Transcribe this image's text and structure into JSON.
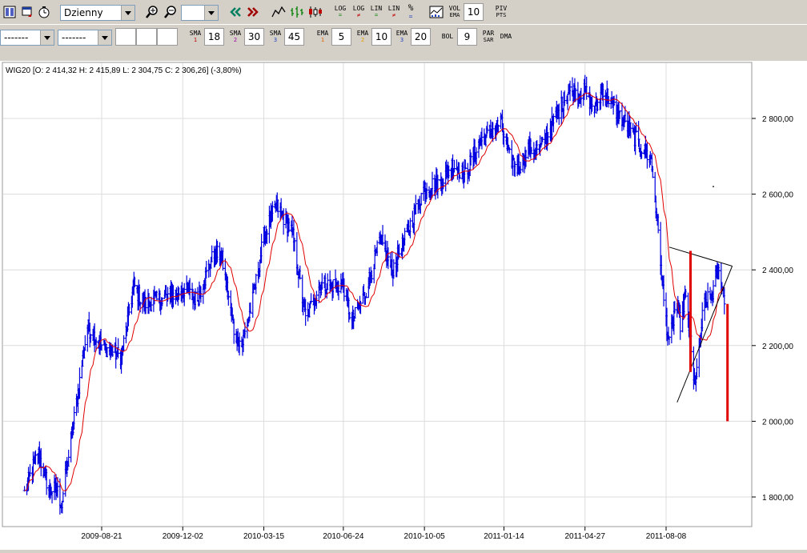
{
  "toolbar": {
    "interval": "Dzienny",
    "period_value": "10",
    "sma_label": "SMA",
    "ema_label": "EMA",
    "sma": [
      {
        "idx": "1",
        "value": "18"
      },
      {
        "idx": "2",
        "value": "30"
      },
      {
        "idx": "3",
        "value": "45"
      }
    ],
    "ema": [
      {
        "idx": "1",
        "value": "5"
      },
      {
        "idx": "2",
        "value": "10"
      },
      {
        "idx": "3",
        "value": "20"
      }
    ],
    "bol_label": "BOL",
    "bol_value": "9",
    "parsar_label1": "PAR",
    "parsar_label2": "SAR",
    "dma_label": "DMA",
    "vol_ema_1": "VOL",
    "vol_ema_2": "EMA",
    "piv_1": "PIV",
    "piv_2": "PTS",
    "log1": "LOG",
    "log2": "LOG",
    "lin1": "LIN",
    "lin2": "LIN",
    "percent": "%",
    "combo_a": "-------",
    "combo_b": "-------"
  },
  "colors": {
    "price": "#0000e0",
    "ma": "#e00000",
    "grid": "#dcdcdc",
    "marker": "#e00000",
    "trendline": "#000000"
  },
  "chart_data": {
    "type": "line",
    "title": "WIG20 [O: 2 414,32  H: 2 415,89  L: 2 304,75  C: 2 306,26] (-3,80%)",
    "y_ticks": [
      "2 800,00",
      "2 600,00",
      "2 400,00",
      "2 200,00",
      "2 000,00",
      "1 800,00"
    ],
    "x_ticks": [
      "2009-08-21",
      "2009-12-02",
      "2010-03-15",
      "2010-06-24",
      "2010-10-05",
      "2011-01-14",
      "2011-04-27",
      "2011-08-08"
    ],
    "ylim": [
      1740,
      2920
    ],
    "xlabel": "",
    "ylabel": "",
    "anchors": [
      [
        "2009-05-15",
        1810
      ],
      [
        "2009-06-01",
        1920
      ],
      [
        "2009-06-15",
        1820
      ],
      [
        "2009-06-25",
        1820
      ],
      [
        "2009-07-01",
        1780
      ],
      [
        "2009-07-20",
        2050
      ],
      [
        "2009-08-03",
        2250
      ],
      [
        "2009-08-21",
        2200
      ],
      [
        "2009-09-15",
        2170
      ],
      [
        "2009-10-01",
        2360
      ],
      [
        "2009-10-12",
        2310
      ],
      [
        "2009-11-02",
        2320
      ],
      [
        "2009-11-25",
        2340
      ],
      [
        "2009-12-02",
        2350
      ],
      [
        "2009-12-20",
        2320
      ],
      [
        "2010-01-10",
        2440
      ],
      [
        "2010-01-20",
        2440
      ],
      [
        "2010-02-05",
        2240
      ],
      [
        "2010-02-15",
        2200
      ],
      [
        "2010-03-01",
        2320
      ],
      [
        "2010-03-15",
        2490
      ],
      [
        "2010-03-31",
        2570
      ],
      [
        "2010-04-20",
        2500
      ],
      [
        "2010-05-07",
        2270
      ],
      [
        "2010-05-25",
        2360
      ],
      [
        "2010-06-10",
        2360
      ],
      [
        "2010-06-24",
        2360
      ],
      [
        "2010-07-05",
        2260
      ],
      [
        "2010-07-22",
        2340
      ],
      [
        "2010-08-10",
        2480
      ],
      [
        "2010-08-25",
        2400
      ],
      [
        "2010-09-10",
        2480
      ],
      [
        "2010-10-05",
        2620
      ],
      [
        "2010-10-25",
        2630
      ],
      [
        "2010-11-10",
        2680
      ],
      [
        "2010-11-25",
        2650
      ],
      [
        "2010-12-15",
        2740
      ],
      [
        "2011-01-10",
        2790
      ],
      [
        "2011-01-20",
        2700
      ],
      [
        "2011-02-01",
        2670
      ],
      [
        "2011-02-15",
        2720
      ],
      [
        "2011-03-01",
        2720
      ],
      [
        "2011-03-20",
        2800
      ],
      [
        "2011-04-05",
        2870
      ],
      [
        "2011-04-27",
        2870
      ],
      [
        "2011-05-10",
        2820
      ],
      [
        "2011-05-20",
        2880
      ],
      [
        "2011-06-05",
        2820
      ],
      [
        "2011-06-20",
        2780
      ],
      [
        "2011-07-05",
        2730
      ],
      [
        "2011-07-20",
        2690
      ],
      [
        "2011-07-28",
        2520
      ],
      [
        "2011-08-05",
        2320
      ],
      [
        "2011-08-12",
        2200
      ],
      [
        "2011-08-20",
        2310
      ],
      [
        "2011-08-26",
        2260
      ],
      [
        "2011-09-01",
        2330
      ],
      [
        "2011-09-07",
        2230
      ],
      [
        "2011-09-12",
        2100
      ],
      [
        "2011-09-18",
        2150
      ],
      [
        "2011-09-24",
        2300
      ],
      [
        "2011-09-30",
        2320
      ],
      [
        "2011-10-06",
        2340
      ],
      [
        "2011-10-12",
        2400
      ],
      [
        "2011-10-18",
        2360
      ],
      [
        "2011-10-21",
        2310
      ]
    ],
    "red_bars": [
      {
        "date": "2011-09-08",
        "from": 2450,
        "to": 2130
      },
      {
        "date": "2011-10-25",
        "from": 2310,
        "to": 2000
      }
    ],
    "trendlines": [
      {
        "from": [
          "2011-08-12",
          2460
        ],
        "to": [
          "2011-10-31",
          2410
        ]
      },
      {
        "from": [
          "2011-08-22",
          2050
        ],
        "to": [
          "2011-10-31",
          2410
        ]
      }
    ],
    "isolated_point": {
      "date": "2011-10-07",
      "value": 2620
    }
  }
}
